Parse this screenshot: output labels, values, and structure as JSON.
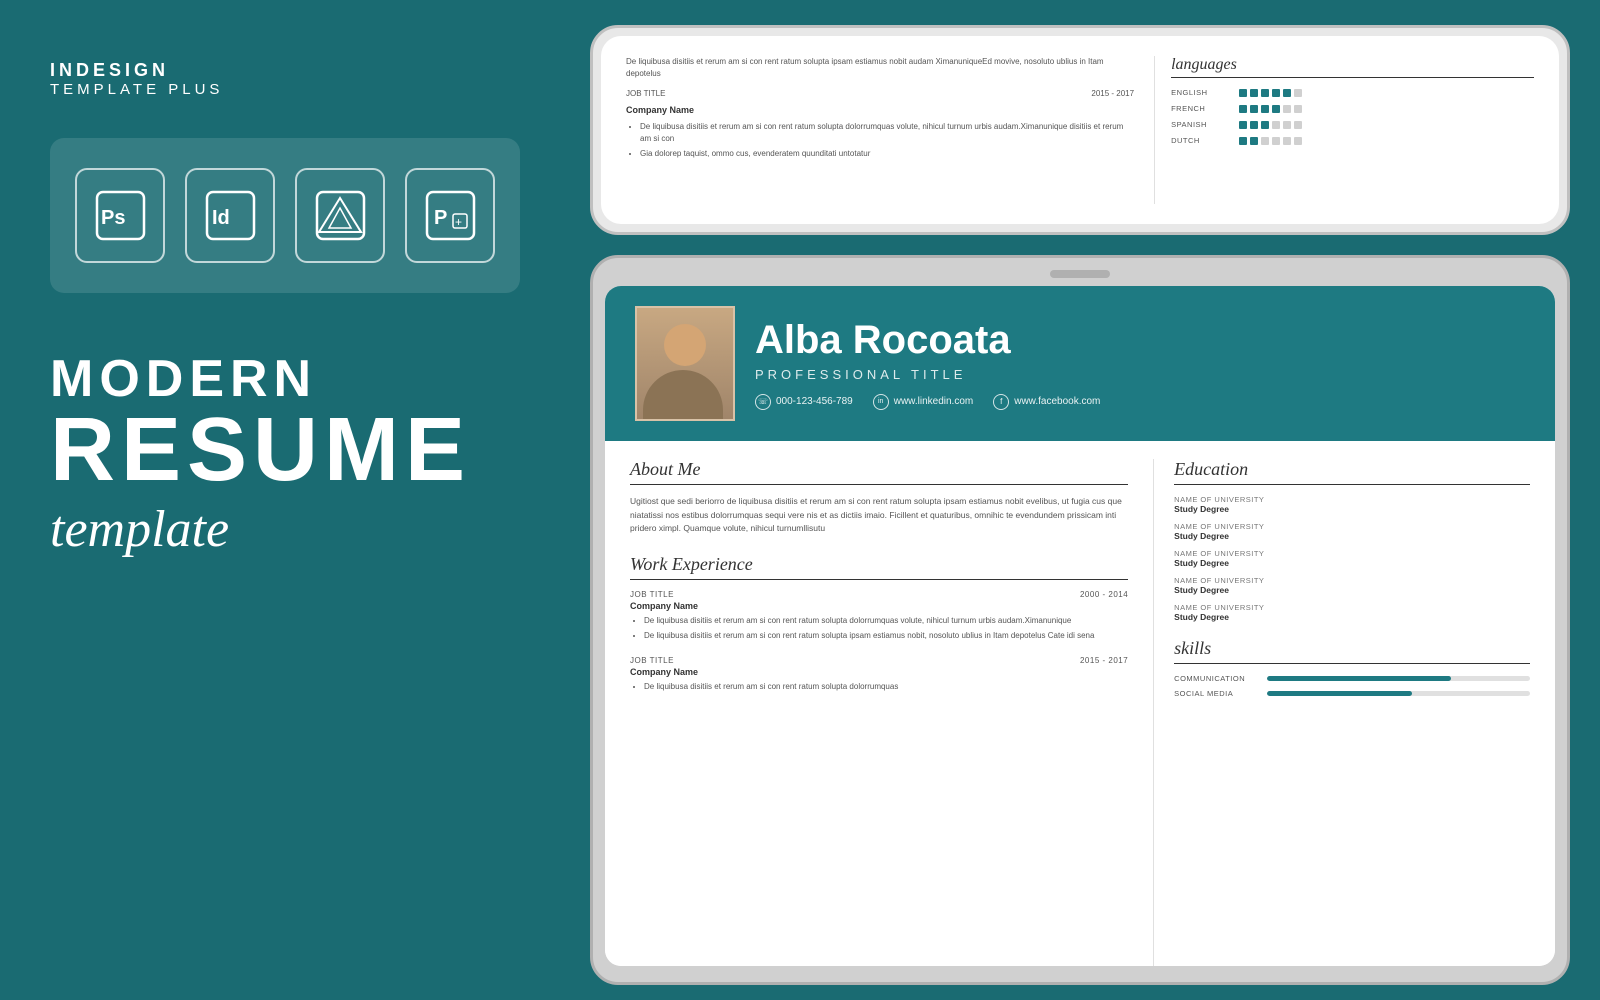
{
  "brand": {
    "line1": "INDESIGN",
    "line2": "TEMPLATE PLUS"
  },
  "software_icons": [
    {
      "name": "Photoshop",
      "abbr": "Ps"
    },
    {
      "name": "InDesign",
      "abbr": "Id"
    },
    {
      "name": "Affinity",
      "abbr": "Af"
    },
    {
      "name": "PowerPoint",
      "abbr": "P"
    }
  ],
  "headline": {
    "line1": "MODERN",
    "line2": "RESUME",
    "line3": "template"
  },
  "resume": {
    "name": "Alba Rocoata",
    "title": "PROFESSIONAL TITLE",
    "phone": "000-123-456-789",
    "linkedin": "www.linkedin.com",
    "facebook": "www.facebook.com",
    "about_heading": "About Me",
    "about_text": "Ugitiost que sedi beriorro de liquibusa disitiis et rerum am si con rent ratum solupta ipsam estiamus nobit evelibus, ut fugia cus que niatatissi nos estibus dolorrumquas sequi vere nis et as dictiis imaio. Ficillent et quaturibus, omnihic te evendundem prissicam inti pridero ximpl. Quamque volute, nihicul turnumllisutu",
    "work_heading": "Work Experience",
    "jobs": [
      {
        "title": "JOB TITLE",
        "years": "2000 - 2014",
        "company": "Company Name",
        "bullets": [
          "De liquibusa disitiis et rerum am si con rent ratum solupta dolorrumquas volute, nihicul turnum urbis audam.Ximanunique",
          "De liquibusa disitiis et rerum am si con rent ratum solupta ipsam estiamus nobit, nosoluto ublius in Itam depotelus Cate idi sena"
        ]
      },
      {
        "title": "JOB TITLE",
        "years": "2015 - 2017",
        "company": "Company Name",
        "bullets": [
          "De liquibusa disitiis et rerum am si con rent ratum solupta dolorrumquas"
        ]
      }
    ],
    "education_heading": "Education",
    "edu_entries": [
      {
        "uni": "NAME OF UNIVERSITY",
        "degree": "Study Degree"
      },
      {
        "uni": "NAME OF UNIVERSITY",
        "degree": "Study Degree"
      },
      {
        "uni": "NAME OF UNIVERSITY",
        "degree": "Study Degree"
      },
      {
        "uni": "NAME OF UNIVERSITY",
        "degree": "Study Degree"
      },
      {
        "uni": "NAME OF UNIVERSITY",
        "degree": "Study Degree"
      }
    ],
    "skills_heading": "skills",
    "skills": [
      {
        "label": "COMMUNICATION",
        "pct": 70
      },
      {
        "label": "SOCIAL MEDIA",
        "pct": 55
      }
    ]
  },
  "top_card": {
    "job_title": "JOB TITLE",
    "years": "2015 - 2017",
    "company": "Company Name",
    "bullets": [
      "De liquibusa disitiis et rerum am si con rent ratum solupta ipsam estiamus nobit audam XimanuniqueEd movive, nosoluto ublius in Itam depotelus",
      "De liquibusa disitiis et rerum am si con rent ratum solupta dolorrumquas volute, nihicul turnum urbis audam.Ximanunique disitiis et rerum am si con"
    ],
    "languages_heading": "languages",
    "languages": [
      {
        "lang": "ENGLISH",
        "filled": 5,
        "total": 6
      },
      {
        "lang": "FRENCH",
        "filled": 4,
        "total": 6
      },
      {
        "lang": "SPANISH",
        "filled": 3,
        "total": 6
      },
      {
        "lang": "DUTCH",
        "filled": 2,
        "total": 6
      }
    ]
  },
  "colors": {
    "bg": "#1a6b72",
    "teal": "#1e7a82",
    "white": "#ffffff"
  }
}
